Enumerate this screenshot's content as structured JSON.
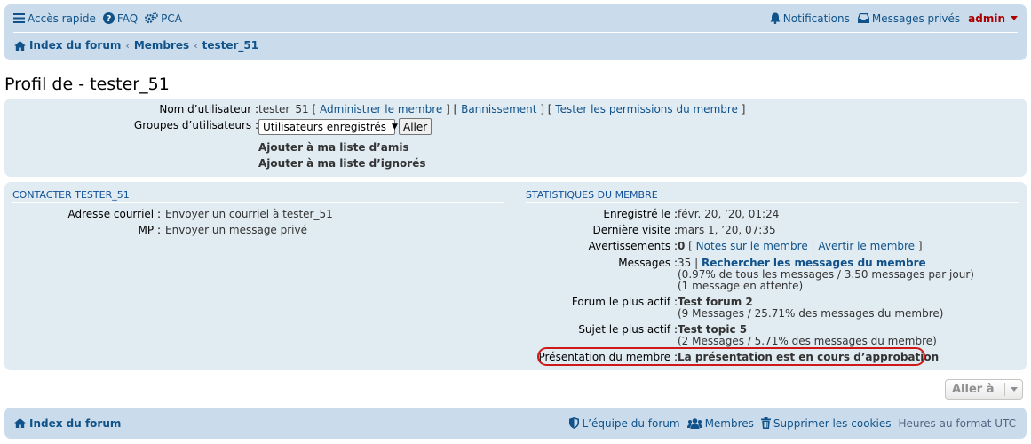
{
  "header": {
    "quick_links": "Accès rapide",
    "faq": "FAQ",
    "acp": "PCA",
    "notifications": "Notifications",
    "private_messages": "Messages privés",
    "username": "admin"
  },
  "breadcrumbs": [
    "Index du forum",
    "Membres",
    "tester_51"
  ],
  "page_title": "Profil de - tester_51",
  "profile": {
    "username_label": "Nom d’utilisateur :",
    "username_value": "tester_51",
    "admin_link": "Administrer le membre",
    "ban_link": "Bannissement",
    "perm_link": "Tester les permissions du membre",
    "groups_label": "Groupes d’utilisateurs :",
    "groups_selected": "Utilisateurs enregistrés",
    "go_button": "Aller",
    "add_friend": "Ajouter à ma liste d’amis",
    "add_foe": "Ajouter à ma liste d’ignorés"
  },
  "contact": {
    "heading": "CONTACTER TESTER_51",
    "email_label": "Adresse courriel :",
    "email_link": "Envoyer un courriel à tester_51",
    "pm_label": "MP :",
    "pm_link": "Envoyer un message privé"
  },
  "stats": {
    "heading": "STATISTIQUES DU MEMBRE",
    "registered_label": "Enregistré le :",
    "registered_value": "févr. 20, ’20, 01:24",
    "last_visit_label": "Dernière visite :",
    "last_visit_value": "mars 1, ’20, 07:35",
    "warnings_label": "Avertissements :",
    "warnings_value": "0",
    "warnings_notes": "Notes sur le membre",
    "warnings_warn": "Avertir le membre",
    "messages_label": "Messages :",
    "messages_count": "35",
    "messages_search": "Rechercher les messages du membre",
    "messages_ratio": "(0.97% de tous les messages / 3.50 messages par jour)",
    "messages_pending": "(1 message en attente)",
    "active_forum_label": "Forum le plus actif :",
    "active_forum_value": "Test forum 2",
    "active_forum_sub": "(9 Messages / 25.71% des messages du membre)",
    "active_topic_label": "Sujet le plus actif :",
    "active_topic_value": "Test topic 5",
    "active_topic_sub": "(2 Messages / 5.71% des messages du membre)",
    "presentation_label": "Présentation du membre :",
    "presentation_value": "La présentation est en cours d’approbation"
  },
  "jump_to": "Aller à",
  "footer": {
    "index": "Index du forum",
    "team": "L’équipe du forum",
    "members": "Membres",
    "delete_cookies": "Supprimer les cookies",
    "timezone": "Heures au format UTC"
  },
  "colors": {
    "link": "#105289",
    "panel": "#e1ebf2",
    "navbar": "#cadceb",
    "admin": "#aa0000",
    "highlight": "#d01818"
  }
}
